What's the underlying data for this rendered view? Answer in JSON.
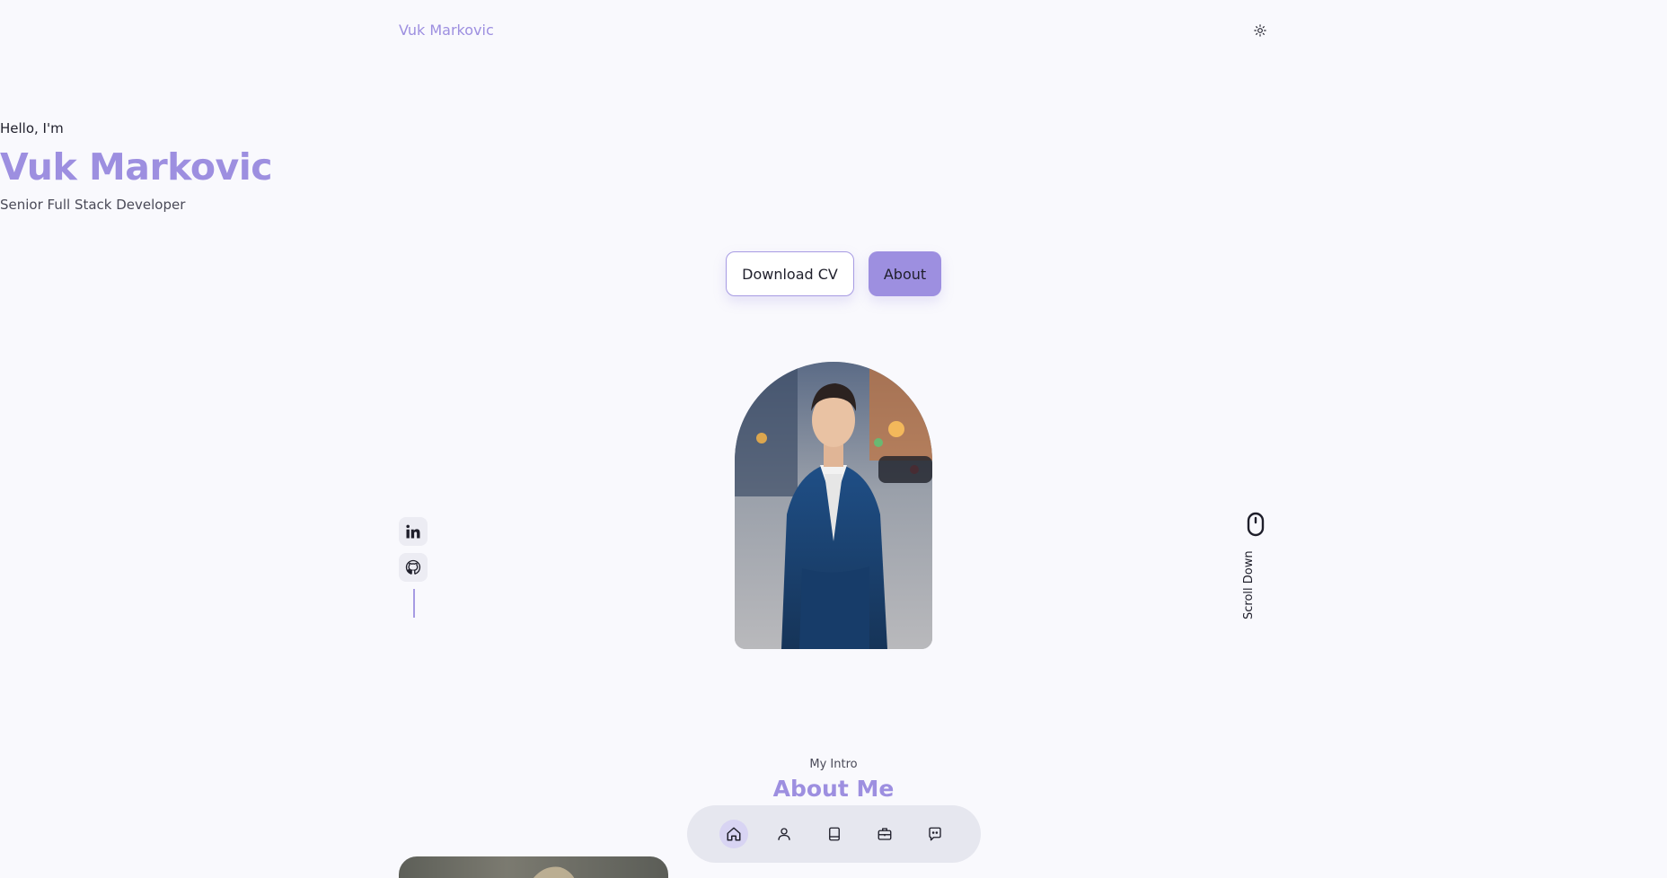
{
  "header": {
    "logo": "Vuk Markovic",
    "theme_icon": "sun-icon"
  },
  "hero": {
    "greeting": "Hello, I'm",
    "name": "Vuk Markovic",
    "role": "Senior Full Stack Developer",
    "download_cv_label": "Download CV",
    "about_label": "About"
  },
  "socials": [
    {
      "icon": "linkedin-icon"
    },
    {
      "icon": "github-icon"
    }
  ],
  "scroll": {
    "label": "Scroll Down",
    "icon": "mouse-icon"
  },
  "intro": {
    "subtitle": "My Intro",
    "title": "About Me"
  },
  "navbar": {
    "items": [
      {
        "icon": "home-icon",
        "active": true
      },
      {
        "icon": "user-icon",
        "active": false
      },
      {
        "icon": "book-icon",
        "active": false
      },
      {
        "icon": "briefcase-icon",
        "active": false
      },
      {
        "icon": "message-icon",
        "active": false
      }
    ]
  },
  "colors": {
    "accent": "#9d8fe0",
    "background": "#f9f9fd",
    "text": "#1f1f2b"
  }
}
